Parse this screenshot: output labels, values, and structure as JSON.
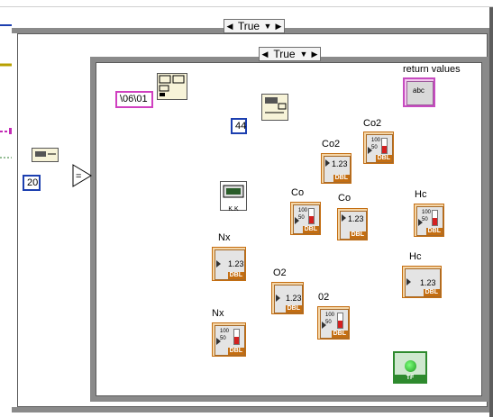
{
  "outer_case": {
    "selector": "True"
  },
  "inner_case": {
    "selector": "True"
  },
  "constants": {
    "string_const": "\\06\\01",
    "num_44": "44",
    "num_20": "20"
  },
  "indicators": {
    "return_values": {
      "label": "return values",
      "type": "abc"
    },
    "co2_num": {
      "label": "Co2",
      "type": "DBL",
      "display": "1.23"
    },
    "co2_therm": {
      "label": "Co2",
      "type": "DBL",
      "scale": [
        "100",
        "50",
        "0"
      ],
      "level": 0.5
    },
    "co_therm": {
      "label": "Co",
      "type": "DBL",
      "scale": [
        "100",
        "50",
        "0"
      ],
      "level": 0.5
    },
    "co_num": {
      "label": "Co",
      "type": "DBL",
      "display": "1.23"
    },
    "hc_therm": {
      "label": "Hc",
      "type": "DBL",
      "scale": [
        "100",
        "50",
        "0"
      ],
      "level": 0.5
    },
    "hc_num": {
      "label": "Hc",
      "type": "DBL",
      "display": "1.23"
    },
    "nx_num": {
      "label": "Nx",
      "type": "DBL",
      "display": "1.23"
    },
    "nx_therm": {
      "label": "Nx",
      "type": "DBL",
      "scale": [
        "100",
        "50",
        "0"
      ],
      "level": 0.5
    },
    "o2_num": {
      "label": "O2",
      "type": "DBL",
      "display": "1.23"
    },
    "o2_therm": {
      "label": "02",
      "type": "DBL",
      "scale": [
        "100",
        "50",
        "0"
      ],
      "level": 0.5
    },
    "bool_led": {
      "type": "TF"
    }
  },
  "subvi": {
    "caption": "K.K"
  },
  "colors": {
    "orange_wire": "#e07a10",
    "pink_wire": "#c32bb5",
    "blue_wire": "#1c3fb0",
    "green_wire": "#2e7d2e",
    "frame": "#8a8a8a"
  }
}
